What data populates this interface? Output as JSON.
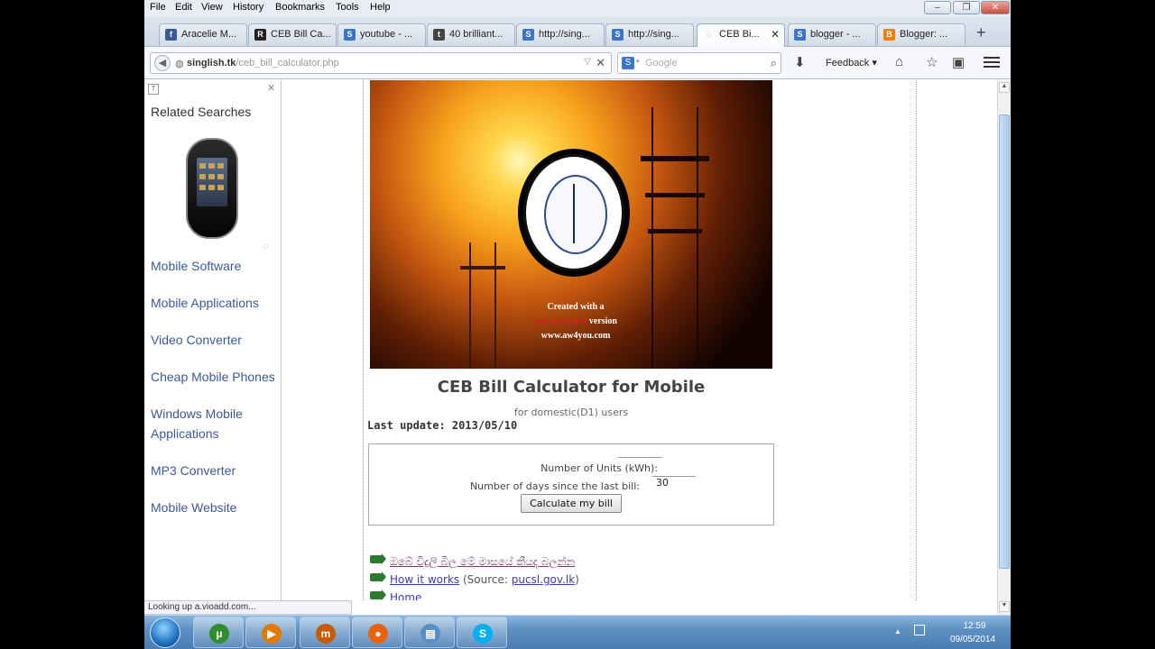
{
  "menubar": {
    "items": [
      "File",
      "Edit",
      "View",
      "History",
      "Bookmarks",
      "Tools",
      "Help"
    ]
  },
  "tabs": [
    {
      "label": "Aracelie M...",
      "icon": "facebook-icon",
      "color": "#3b5998",
      "glyph": "f"
    },
    {
      "label": "CEB Bill Ca...",
      "icon": "r-site-icon",
      "color": "#222222",
      "glyph": "R"
    },
    {
      "label": "youtube - ...",
      "icon": "s-site-icon",
      "color": "#3b74c9",
      "glyph": "S"
    },
    {
      "label": "40 brilliant...",
      "icon": "tumblr-icon",
      "color": "#444444",
      "glyph": "t"
    },
    {
      "label": "http://sing...",
      "icon": "s-site-icon",
      "color": "#3b74c9",
      "glyph": "S"
    },
    {
      "label": "http://sing...",
      "icon": "s-site-icon",
      "color": "#3b74c9",
      "glyph": "S"
    },
    {
      "label": "CEB Bi...",
      "icon": "loading-icon",
      "color": "#9aa6b4",
      "glyph": "◌",
      "active": true
    },
    {
      "label": "blogger - ...",
      "icon": "s-site-icon",
      "color": "#3b74c9",
      "glyph": "S"
    },
    {
      "label": "Blogger: ...",
      "icon": "blogger-icon",
      "color": "#f57d00",
      "glyph": "B"
    }
  ],
  "navbar": {
    "url_domain": "singlish.tk",
    "url_path": "/ceb_bill_calculator.php",
    "search_placeholder": "Google",
    "feedback_label": "Feedback"
  },
  "sidebar": {
    "heading": "Related Searches",
    "ad_mark": "□",
    "links": [
      "Mobile Software",
      "Mobile Applications",
      "Video Converter",
      "Cheap Mobile Phones",
      "Windows Mobile Applications",
      "MP3 Converter",
      "Mobile Website"
    ]
  },
  "banner": {
    "caption_line1": "Created with a",
    "caption_red": "non-activated",
    "caption_line2_rest": " version",
    "caption_line3": "www.aw4you.com"
  },
  "page": {
    "title": "CEB Bill Calculator for Mobile",
    "subtitle": "for domestic(D1) users",
    "last_update": "Last update: 2013/05/10"
  },
  "form": {
    "units_label": "Number of Units (kWh):",
    "units_value": "",
    "days_label": "Number of days since the last bill:",
    "days_value": "30",
    "button_label": "Calculate my bill"
  },
  "links": {
    "sinhala": "ඔබේ විදුලි බිල මේ මාසයේ කීයද බලන්න",
    "how_it_works": "How it works",
    "source_prefix": " (Source: ",
    "source_link": "pucsl.gov.lk",
    "source_suffix": ")",
    "home": "Home"
  },
  "status": {
    "text": "Looking up a.vioadd.com..."
  },
  "taskbar": {
    "apps": [
      {
        "name": "utorrent-icon",
        "glyph": "µ",
        "color": "#2f8f2f"
      },
      {
        "name": "media-player-icon",
        "glyph": "▶",
        "color": "#e07b00"
      },
      {
        "name": "media-app-icon",
        "glyph": "m",
        "color": "#c85a00"
      },
      {
        "name": "firefox-icon",
        "glyph": "●",
        "color": "#e8620c"
      },
      {
        "name": "file-manager-icon",
        "glyph": "▤",
        "color": "#5a8fc6"
      },
      {
        "name": "skype-icon",
        "glyph": "S",
        "color": "#00aff0"
      }
    ],
    "clock_time": "12:59",
    "clock_date": "09/05/2014"
  }
}
